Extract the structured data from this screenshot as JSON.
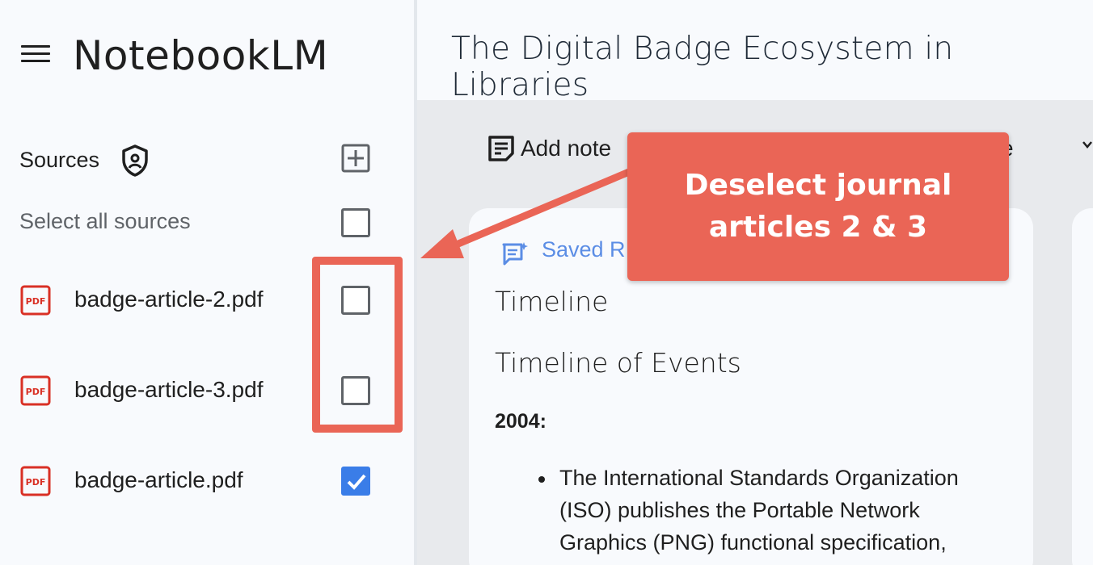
{
  "app": {
    "title": "NotebookLM"
  },
  "sidebar": {
    "sources_label": "Sources",
    "select_all_label": "Select all sources",
    "select_all_checked": false,
    "sources": [
      {
        "name": "badge-article-2.pdf",
        "icon": "pdf-icon",
        "checked": false
      },
      {
        "name": "badge-article-3.pdf",
        "icon": "pdf-icon",
        "checked": false
      },
      {
        "name": "badge-article.pdf",
        "icon": "pdf-icon",
        "checked": true
      }
    ]
  },
  "main": {
    "notebook_title": "The Digital Badge Ecosystem in Libraries",
    "toolbar": {
      "add_note_label": "Add note",
      "partial_button_tail": "e"
    },
    "note": {
      "saved_label": "Saved R",
      "heading": "Timeline",
      "subheading": "Timeline of Events",
      "year": "2004:",
      "bullet": "The International Standards Organization (ISO) publishes the Portable Network Graphics (PNG) functional specification,"
    }
  },
  "annotation": {
    "callout_text": "Deselect journal articles 2 & 3",
    "color": "#ea6556"
  },
  "colors": {
    "accent_blue": "#3a7de8",
    "pdf_red": "#d93025",
    "annotation_red": "#ea6556"
  }
}
